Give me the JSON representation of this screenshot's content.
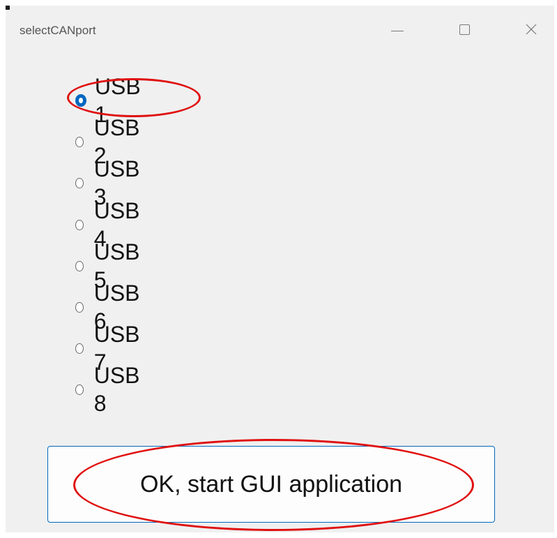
{
  "window": {
    "title": "selectCANport"
  },
  "title_controls": {
    "minimize_icon": "minimize-icon",
    "maximize_icon": "maximize-icon",
    "close_icon": "close-icon"
  },
  "colors": {
    "accent": "#0067c0",
    "highlight": "#e01010",
    "background": "#f0f0f0"
  },
  "ports": {
    "selected": "USB 1",
    "options": [
      {
        "label": "USB 1",
        "checked": true
      },
      {
        "label": "USB 2",
        "checked": false
      },
      {
        "label": "USB 3",
        "checked": false
      },
      {
        "label": "USB 4",
        "checked": false
      },
      {
        "label": "USB 5",
        "checked": false
      },
      {
        "label": "USB 6",
        "checked": false
      },
      {
        "label": "USB 7",
        "checked": false
      },
      {
        "label": "USB 8",
        "checked": false
      }
    ]
  },
  "ok_button": {
    "label": "OK, start GUI application"
  }
}
